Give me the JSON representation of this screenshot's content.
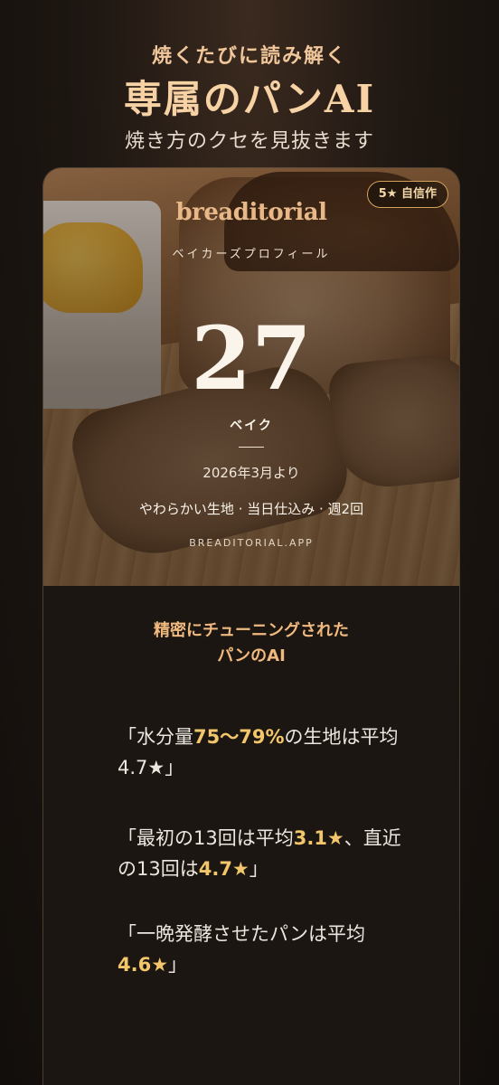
{
  "hero": {
    "kicker": "焼くたびに読み解く",
    "title": "専属のパンAI",
    "subtitle": "焼き方のクセを見抜きます"
  },
  "card": {
    "badge": "5★ 自信作",
    "brand": "breaditorial",
    "profile_label": "ベイカーズプロフィール",
    "bake_count": "27",
    "bake_unit": "ベイク",
    "since": "2026年3月より",
    "traits": "やわらかい生地 · 当日仕込み · 週2回",
    "url": "BREADITORIAL.APP"
  },
  "insights": {
    "title_line1": "精密にチューニングされた",
    "title_line2": "パンのAI",
    "quotes": [
      {
        "before": "「水分量",
        "highlight": "75〜79%",
        "after": "の生地は平均4.7★」",
        "highlight2": ""
      },
      {
        "before": "「最初の13回は平均",
        "highlight": "3.1★",
        "after": "、直近の13回は",
        "highlight2": "4.7★",
        "end": "」"
      },
      {
        "before": "「一晩発酵させたパンは平均",
        "highlight": "4.6★",
        "after": "」"
      }
    ]
  },
  "colors": {
    "accent": "#f0b97e",
    "highlight": "#f2c66a",
    "background": "#1e1712"
  }
}
